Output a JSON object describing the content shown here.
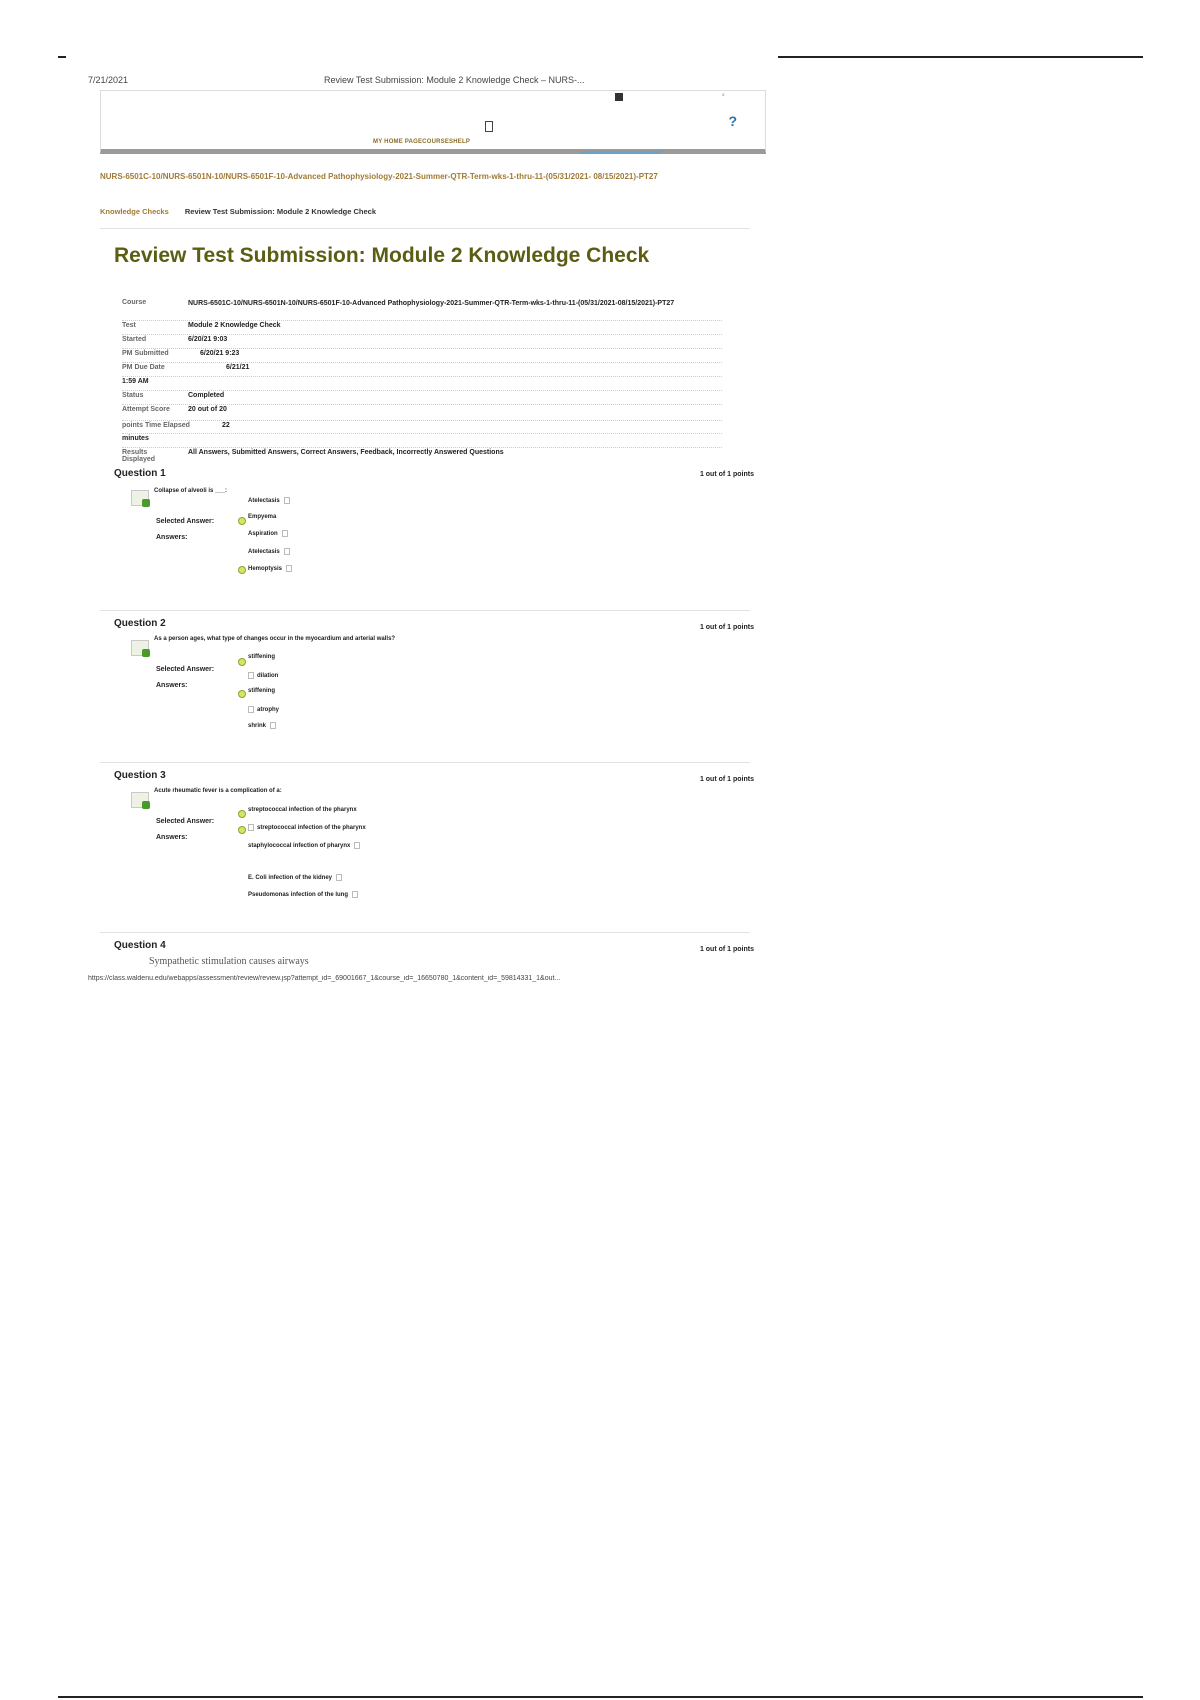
{
  "print_header": {
    "date": "7/21/2021",
    "title": "Review Test Submission: Module 2 Knowledge Check – NURS-..."
  },
  "topbar": {
    "nav_links": "MY HOME PAGECOURSESHELP",
    "help": "?"
  },
  "course_link": "NURS-6501C-10/NURS-6501N-10/NURS-6501F-10-Advanced Pathophysiology-2021-Summer-QTR-Term-wks-1-thru-11-(05/31/2021- 08/15/2021)-PT27",
  "breadcrumbs": [
    "Knowledge Checks",
    "Review Test Submission: Module 2 Knowledge Check"
  ],
  "page_title": "Review Test Submission: Module 2 Knowledge Check",
  "details": [
    {
      "label": "Course",
      "value": "NURS-6501C-10/NURS-6501N-10/NURS-6501F-10-Advanced Pathophysiology-2021-Summer-QTR-Term-wks-1-thru-11-(05/31/2021-08/15/2021)-PT27"
    },
    {
      "label": "Test",
      "value": "Module 2 Knowledge Check"
    },
    {
      "label": "Started",
      "value": "6/20/21 9:03"
    },
    {
      "label": "PM Submitted",
      "value": "6/20/21 9:23"
    },
    {
      "label": "PM Due Date",
      "value": "6/21/21"
    },
    {
      "label": "1:59 AM",
      "value": ""
    },
    {
      "label": "Status",
      "value": "Completed"
    },
    {
      "label": "Attempt Score",
      "value": "20 out of 20"
    },
    {
      "label": "points Time Elapsed",
      "value": "22"
    },
    {
      "label": "minutes",
      "value": ""
    },
    {
      "label": "Results Displayed",
      "value": "All Answers, Submitted Answers, Correct Answers, Feedback, Incorrectly Answered Questions"
    }
  ],
  "questions": [
    {
      "title": "Question 1",
      "points": "1 out of 1 points",
      "text": "Collapse of alveoli is ___:",
      "selected_label": "Selected Answer:",
      "answers_label": "Answers:",
      "options": [
        "Atelectasis",
        "Empyema",
        "Aspiration",
        "Atelectasis",
        "Hemoptysis"
      ]
    },
    {
      "title": "Question 2",
      "points": "1 out of 1 points",
      "text": "As a person ages, what type of changes occur in the myocardium and arterial walls?",
      "selected_label": "Selected Answer:",
      "answers_label": "Answers:",
      "options": [
        "stiffening",
        "dilation",
        "stiffening",
        "atrophy",
        "shrink"
      ]
    },
    {
      "title": "Question 3",
      "points": "1 out of 1 points",
      "text": "Acute rheumatic fever is a complication of a:",
      "selected_label": "Selected Answer:",
      "answers_label": "Answers:",
      "options": [
        "streptococcal infection of the pharynx",
        "streptococcal infection of the pharynx",
        "staphylococcal infection of pharynx",
        "E. Coli infection of the kidney",
        "Pseudomonas infection of the lung"
      ]
    },
    {
      "title": "Question 4",
      "points": "1 out of 1 points",
      "text": "Sympathetic stimulation causes airways"
    }
  ],
  "print_footer_url": "https://class.waldenu.edu/webapps/assessment/review/review.jsp?attempt_id=_69001667_1&course_id=_16650780_1&content_id=_59814331_1&out..."
}
